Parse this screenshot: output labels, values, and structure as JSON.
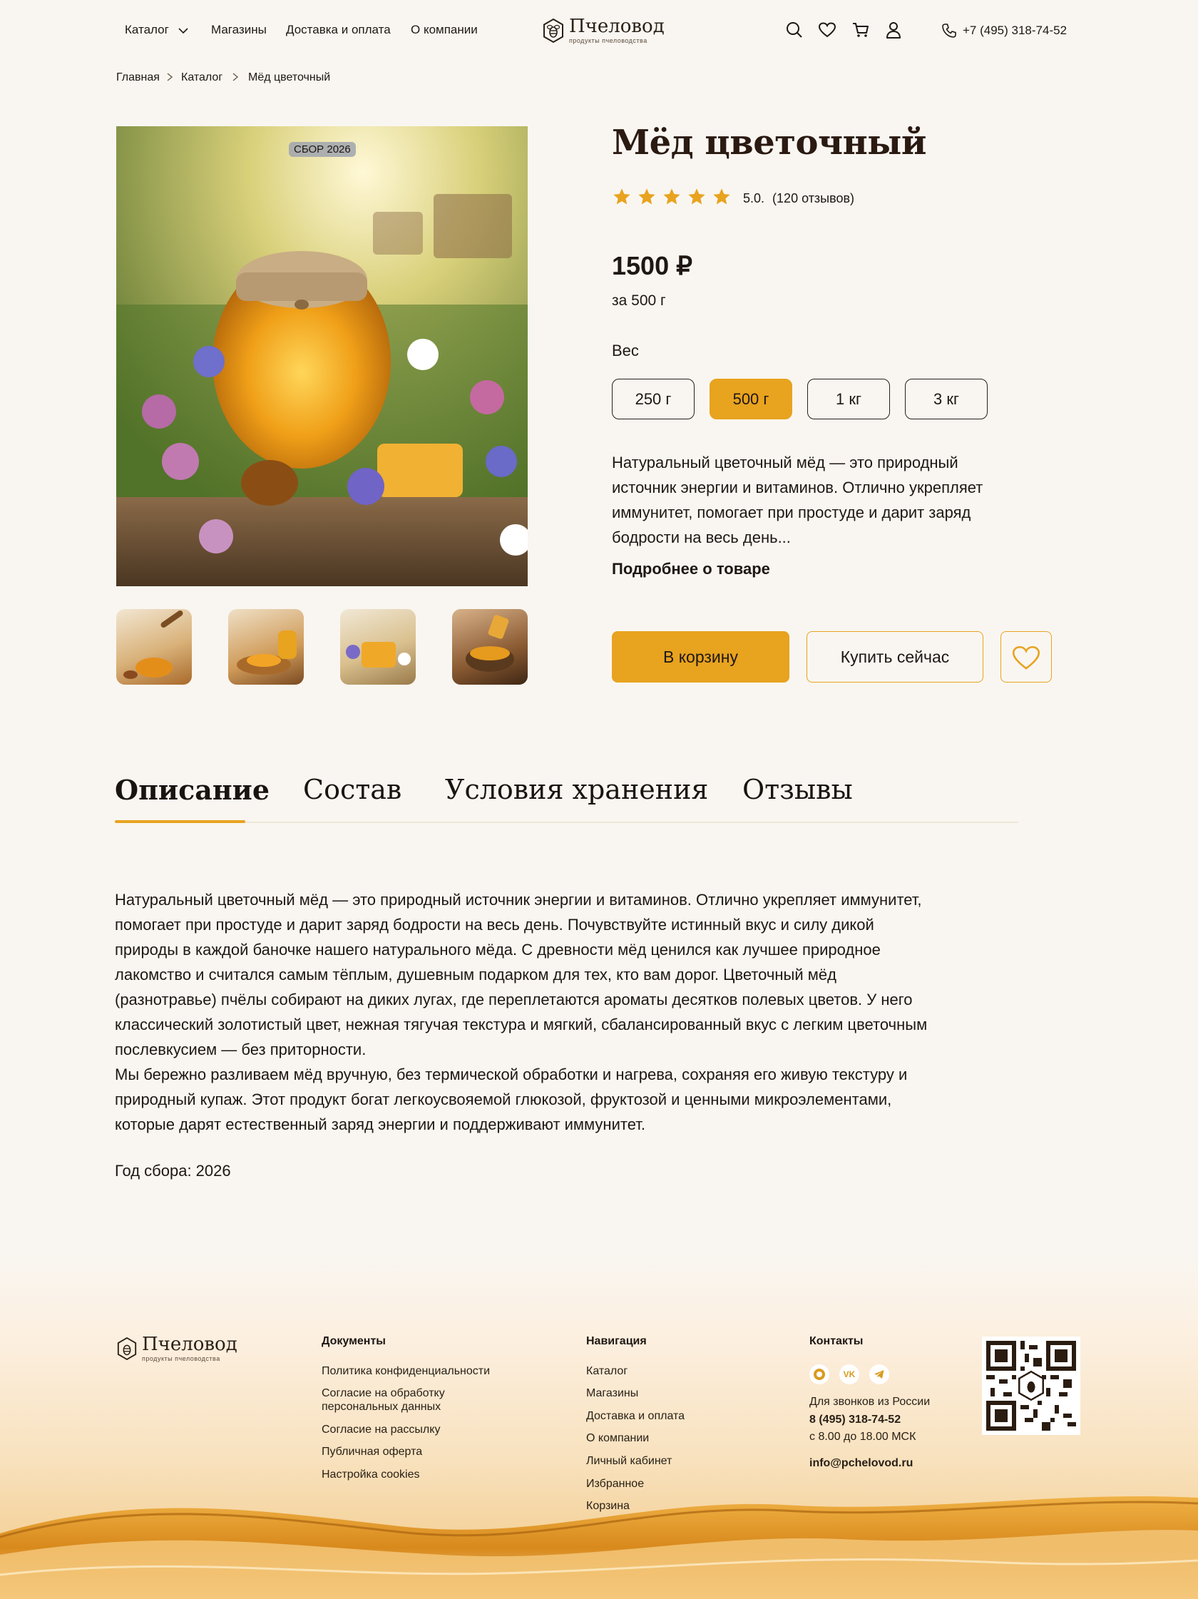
{
  "header": {
    "nav": [
      "Каталог",
      "Магазины",
      "Доставка и оплата",
      "О компании"
    ],
    "logo_name": "Пчеловод",
    "logo_sub": "продукты пчеловодства",
    "phone": "+7 (495) 318-74-52"
  },
  "breadcrumb": [
    "Главная",
    "Каталог",
    "Мёд цветочный"
  ],
  "gallery": {
    "badge": "СБОР 2026"
  },
  "product": {
    "title": "Мёд цветочный",
    "rating": "5.0.",
    "reviews": "(120 отзывов)",
    "stars": 5,
    "price": "1500 ₽",
    "per": "за 500 г",
    "weight_label": "Вес",
    "weights": [
      "250 г",
      "500 г",
      "1 кг",
      "3 кг"
    ],
    "selected_weight": "500 г",
    "short_description": "Натуральный цветочный мёд — это природный источник энергии и витаминов. Отлично укрепляет иммунитет, помогает при простуде и дарит заряд бодрости на весь день...",
    "more_link": "Подробнее о товаре",
    "cart_button": "В корзину",
    "buy_button": "Купить сейчас"
  },
  "tabs": [
    "Описание",
    "Состав",
    "Условия хранения",
    "Отзывы"
  ],
  "description": {
    "paragraphs": [
      "Натуральный цветочный мёд — это природный источник энергии и витаминов. Отлично укрепляет иммунитет, помогает при простуде и дарит заряд бодрости на весь день. Почувствуйте истинный вкус и силу дикой природы в каждой баночке нашего натурального мёда. С древности мёд ценился как лучшее природное лакомство и считался самым тёплым, душевным подарком для тех, кто вам дорог. Цветочный мёд (разнотравье) пчёлы собирают на диких лугах, где переплетаются ароматы десятков полевых цветов. У него классический золотистый цвет, нежная тягучая текстура и мягкий, сбалансированный вкус с легким цветочным послевкусием — без приторности.",
      "Мы бережно разливаем мёд вручную, без термической обработки и нагрева, сохраняя его живую текстуру и природный купаж. Этот продукт богат легкоусвояемой глюкозой, фруктозой и ценными микроэлементами, которые дарят естественный заряд энергии и поддерживают иммунитет."
    ],
    "year": "Год сбора: 2026"
  },
  "footer": {
    "docs_title": "Документы",
    "docs": [
      "Политика конфиденциальности",
      "Согласие на обработку",
      "персональных данных",
      "Согласие на рассылку",
      "Публичная оферта",
      "Настройка cookies"
    ],
    "nav_title": "Навигация",
    "nav": [
      "Каталог",
      "Магазины",
      "Доставка и оплата",
      "О компании",
      "Личный кабинет",
      "Избранное",
      "Корзина"
    ],
    "contacts_title": "Контакты",
    "calls_label": "Для звонков из России",
    "phone": "8 (495) 318-74-52",
    "hours": "с 8.00 до 18.00 МСК",
    "email": "info@pchelovod.ru",
    "social_vk": "VK"
  },
  "colors": {
    "accent": "#e8a31f",
    "background": "#f9f6f1",
    "text": "#1e1712"
  }
}
